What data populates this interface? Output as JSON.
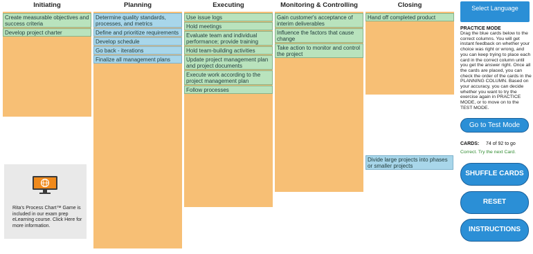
{
  "columns": [
    {
      "title": "Initiating"
    },
    {
      "title": "Planning"
    },
    {
      "title": "Executing"
    },
    {
      "title": "Monitoring & Controlling"
    },
    {
      "title": "Closing"
    }
  ],
  "cards": {
    "initiating": [
      {
        "text": "Create measurable objectives and success criteria",
        "color": "green"
      },
      {
        "text": "Develop project charter",
        "color": "green"
      }
    ],
    "planning": [
      {
        "text": "Determine quality standards, processes, and metrics",
        "color": "blue"
      },
      {
        "text": "Define and prioritize requirements",
        "color": "blue"
      },
      {
        "text": "Develop schedule",
        "color": "blue"
      },
      {
        "text": "Go back - iterations",
        "color": "blue"
      },
      {
        "text": "Finalize all management plans",
        "color": "blue"
      }
    ],
    "executing": [
      {
        "text": "Use issue logs",
        "color": "green"
      },
      {
        "text": "Hold meetings",
        "color": "green"
      },
      {
        "text": "Evaluate team and individual performance; provide training",
        "color": "green"
      },
      {
        "text": "Hold team-building activities",
        "color": "green"
      },
      {
        "text": "Update project management plan and project documents",
        "color": "green"
      },
      {
        "text": "Execute work according to the project management plan",
        "color": "green"
      },
      {
        "text": "Follow processes",
        "color": "green"
      }
    ],
    "monitoring": [
      {
        "text": "Gain customer's acceptance of interim deliverables",
        "color": "green"
      },
      {
        "text": "Influence the factors that cause change",
        "color": "green"
      },
      {
        "text": "Take action to monitor and control the project",
        "color": "green"
      }
    ],
    "closing": [
      {
        "text": "Hand off completed product",
        "color": "green"
      }
    ],
    "unplaced": [
      {
        "text": "Divide large projects into phases or smaller projects",
        "color": "blue"
      }
    ]
  },
  "promo": {
    "text": "Rita's Process Chart™ Game is included in our exam prep eLearning course. Click Here for more information.",
    "icon": "monitor-globe-icon"
  },
  "sidebar": {
    "language_button": "Select Language",
    "mode_title": "PRACTICE MODE",
    "instructions": "Drag the blue cards below to the correct columns. You will get instant feedback on whether your choice was right or wrong, and you can keep trying to place each card in the correct column until you get the answer right. Once all the cards are placed, you can check the order of the cards in the PLANNING COLUMN. Based on your accuracy, you can decide whether you want to try the exercise again in PRACTICE MODE, or to move on to the TEST MODE.",
    "test_mode_button": "Go to Test Mode",
    "cards_label": "CARDS:",
    "cards_count": "74 of 92 to go",
    "feedback": "Correct. Try the next Card.",
    "shuffle_button": "SHUFFLE CARDS",
    "reset_button": "RESET",
    "instructions_button": "INSTRUCTIONS"
  },
  "colors": {
    "column_bg": "#f7bf75",
    "card_green": "#b9e3bd",
    "card_blue": "#a8d6ea",
    "button_blue": "#2b8fd6",
    "feedback_green": "#2e8b2e"
  }
}
